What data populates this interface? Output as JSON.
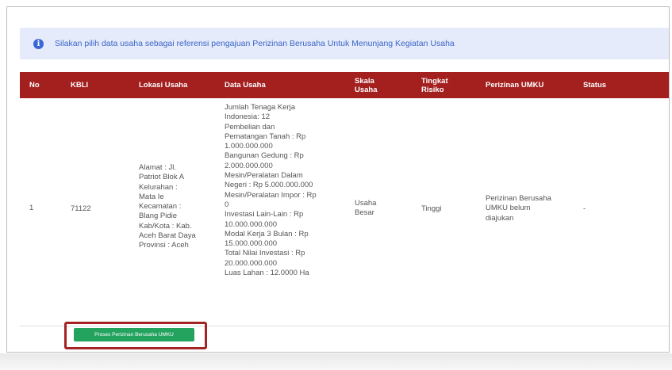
{
  "alert": {
    "icon": "info-icon",
    "message": "Silakan pilih data usaha sebagai referensi pengajuan Perizinan Berusaha Untuk Menunjang Kegiatan Usaha"
  },
  "table": {
    "headers": {
      "no": "No",
      "kbli": "KBLI",
      "lokasi": "Lokasi Usaha",
      "data": "Data Usaha",
      "skala": [
        "Skala",
        "Usaha"
      ],
      "tingkat": [
        "Tingkat",
        "Risiko"
      ],
      "perizinan": "Perizinan UMKU",
      "status": "Status"
    },
    "row": {
      "no": "1",
      "kbli": "71122",
      "lokasi": [
        "Alamat : Jl.",
        "Patriot Blok A",
        "Kelurahan :",
        "Mata Ie",
        "Kecamatan :",
        "Blang Pidie",
        "Kab/Kota : Kab.",
        "Aceh Barat Daya",
        "Provinsi : Aceh"
      ],
      "data": [
        "Jumlah Tenaga Kerja",
        "Indonesia: 12",
        "Pembelian dan",
        "Pematangan Tanah : Rp",
        "1.000.000.000",
        "Bangunan Gedung : Rp",
        "2.000.000.000",
        "Mesin/Peralatan Dalam",
        "Negeri : Rp 5.000.000.000",
        "Mesin/Peralatan Impor : Rp",
        "0",
        "Investasi Lain-Lain : Rp",
        "10.000.000.000",
        "Modal Kerja 3 Bulan : Rp",
        "15.000.000.000",
        "Total Nilai Investasi : Rp",
        "20.000.000.000",
        "Luas Lahan : 12.0000 Ha"
      ],
      "skala": [
        "Usaha",
        "Besar"
      ],
      "tingkat": "Tinggi",
      "perizinan": [
        "Perizinan Berusaha",
        "UMKU belum",
        "diajukan"
      ],
      "status": "-"
    },
    "action_button": "Proses Perizinan Berusaha UMKU"
  },
  "colors": {
    "header_bg": "#a3201f",
    "alert_bg": "#e5ebfa",
    "alert_text": "#3b65c8",
    "button_bg": "#24a35f",
    "highlight_border": "#a42224"
  }
}
